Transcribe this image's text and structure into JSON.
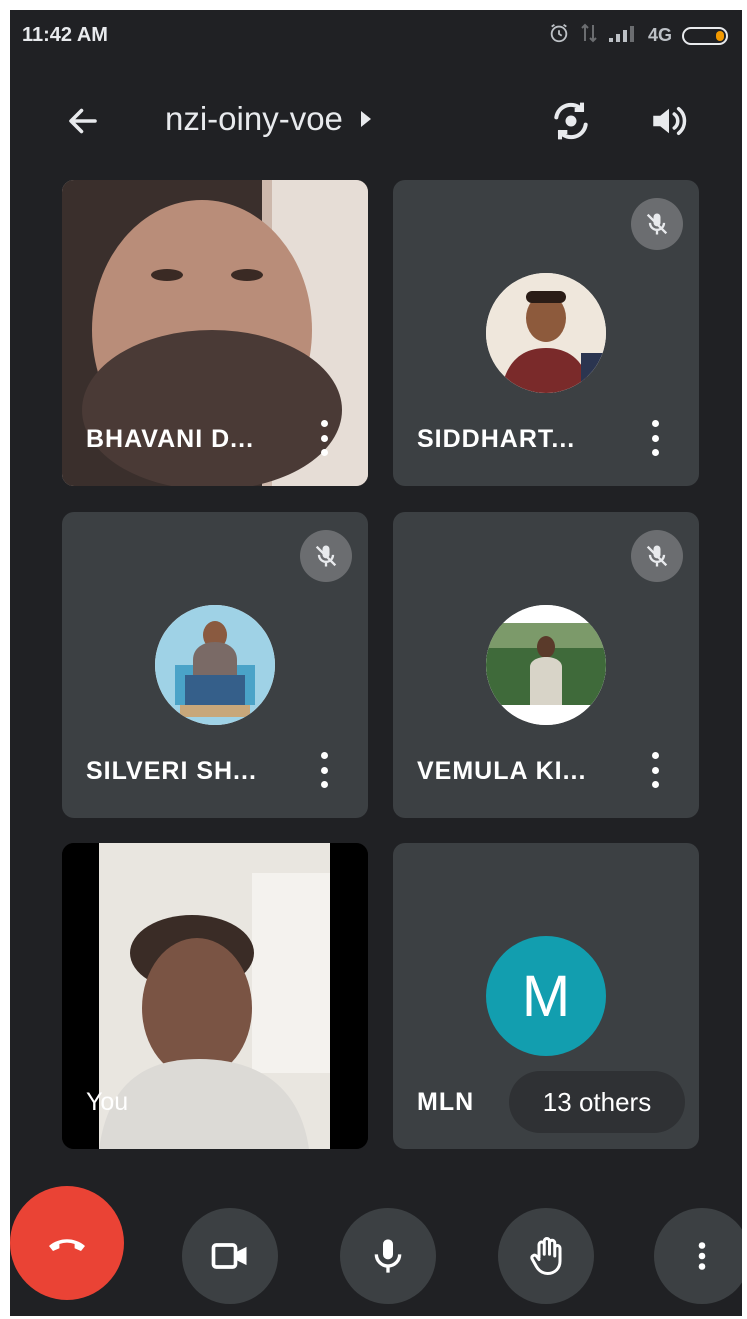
{
  "status_bar": {
    "time": "11:42 AM",
    "network": "4G",
    "icons": [
      "alarm-icon",
      "data-transfer-icon",
      "signal-icon",
      "battery-icon"
    ]
  },
  "top_bar": {
    "meeting_code": "nzi-oiny-voe",
    "icons": [
      "back-arrow-icon",
      "meeting-details-chevron-icon",
      "switch-camera-icon",
      "speaker-icon"
    ]
  },
  "participants": [
    {
      "name": "BHAVANI D...",
      "muted": false,
      "video": true
    },
    {
      "name": "SIDDHART...",
      "muted": true,
      "video": false
    },
    {
      "name": "SILVERI SH...",
      "muted": true,
      "video": false
    },
    {
      "name": "VEMULA KI...",
      "muted": true,
      "video": false
    },
    {
      "name": "You",
      "muted": false,
      "video": true
    },
    {
      "name": "MLN",
      "avatar_letter": "M",
      "others_label": "13 others"
    }
  ],
  "controls": {
    "icons": [
      "end-call-icon",
      "camera-icon",
      "microphone-icon",
      "raise-hand-icon",
      "more-options-icon"
    ]
  },
  "colors": {
    "background": "#202124",
    "tile": "#3c4043",
    "end_call": "#ea4335",
    "avatar_teal": "#129eaf",
    "mute_badge": "#6b6d70"
  }
}
